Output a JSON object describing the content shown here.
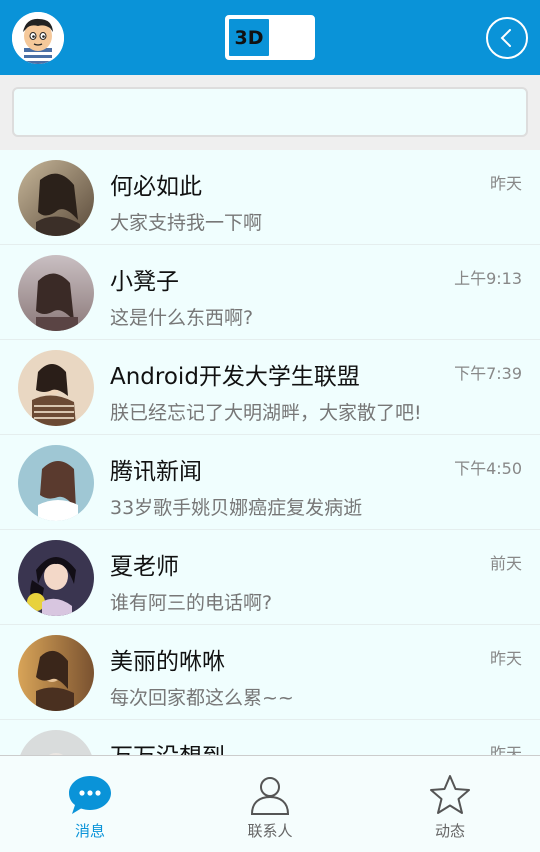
{
  "header": {
    "toggle_label": "3D",
    "accent": "#0a93d8"
  },
  "search": {
    "placeholder": ""
  },
  "conversations": [
    {
      "name": "何必如此",
      "message": "大家支持我一下啊",
      "time": "昨天",
      "avatar": "girl-photo"
    },
    {
      "name": "小凳子",
      "message": "这是什么东西啊?",
      "time": "上午9:13",
      "avatar": "girl-photo"
    },
    {
      "name": "Android开发大学生联盟",
      "message": "朕已经忘记了大明湖畔，大家散了吧!",
      "time": "下午7:39",
      "avatar": "girl-photo"
    },
    {
      "name": "腾讯新闻",
      "message": "33岁歌手姚贝娜癌症复发病逝",
      "time": "下午4:50",
      "avatar": "girl-photo"
    },
    {
      "name": "夏老师",
      "message": "谁有阿三的电话啊?",
      "time": "前天",
      "avatar": "girl-photo"
    },
    {
      "name": "美丽的咻咻",
      "message": "每次回家都这么累~~",
      "time": "昨天",
      "avatar": "girl-photo"
    },
    {
      "name": "万万没想到",
      "message": "",
      "time": "昨天",
      "avatar": "girl-photo"
    }
  ],
  "tabs": [
    {
      "label": "消息",
      "icon": "chat-bubble-icon",
      "active": true
    },
    {
      "label": "联系人",
      "icon": "person-icon",
      "active": false
    },
    {
      "label": "动态",
      "icon": "star-icon",
      "active": false
    }
  ]
}
